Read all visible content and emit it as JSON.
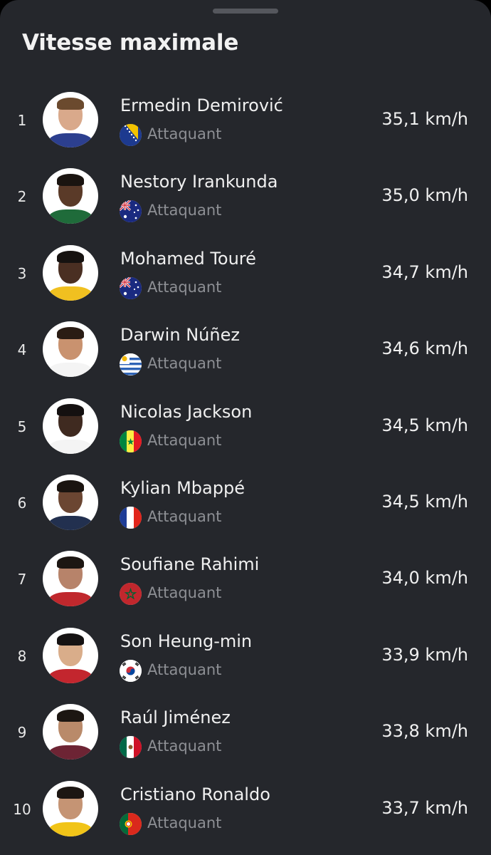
{
  "sheet": {
    "title": "Vitesse maximale"
  },
  "players": [
    {
      "rank": "1",
      "name": "Ermedin Demirović",
      "position": "Attaquant",
      "speed": "35,1 km/h",
      "flag_icon": "bosnia-flag-icon",
      "skin": "#d9a98b",
      "hair": "#6b4a2e",
      "shirt": "#2c3f8f"
    },
    {
      "rank": "2",
      "name": "Nestory Irankunda",
      "position": "Attaquant",
      "speed": "35,0 km/h",
      "flag_icon": "australia-flag-icon",
      "skin": "#5a3a28",
      "hair": "#1a1410",
      "shirt": "#1f6b3a"
    },
    {
      "rank": "3",
      "name": "Mohamed Touré",
      "position": "Attaquant",
      "speed": "34,7 km/h",
      "flag_icon": "australia-flag-icon",
      "skin": "#4a2f22",
      "hair": "#161210",
      "shirt": "#f0c020"
    },
    {
      "rank": "4",
      "name": "Darwin Núñez",
      "position": "Attaquant",
      "speed": "34,6 km/h",
      "flag_icon": "uruguay-flag-icon",
      "skin": "#c9926f",
      "hair": "#2a1c14",
      "shirt": "#f4f4f4"
    },
    {
      "rank": "5",
      "name": "Nicolas Jackson",
      "position": "Attaquant",
      "speed": "34,5 km/h",
      "flag_icon": "senegal-flag-icon",
      "skin": "#3f2a20",
      "hair": "#141010",
      "shirt": "#f4f4f4"
    },
    {
      "rank": "6",
      "name": "Kylian Mbappé",
      "position": "Attaquant",
      "speed": "34,5 km/h",
      "flag_icon": "france-flag-icon",
      "skin": "#6b4632",
      "hair": "#1a1410",
      "shirt": "#22304f"
    },
    {
      "rank": "7",
      "name": "Soufiane Rahimi",
      "position": "Attaquant",
      "speed": "34,0 km/h",
      "flag_icon": "morocco-flag-icon",
      "skin": "#b7836a",
      "hair": "#1c1612",
      "shirt": "#c0282d"
    },
    {
      "rank": "8",
      "name": "Son Heung-min",
      "position": "Attaquant",
      "speed": "33,9 km/h",
      "flag_icon": "south-korea-flag-icon",
      "skin": "#d9ad8a",
      "hair": "#151212",
      "shirt": "#c3262e"
    },
    {
      "rank": "9",
      "name": "Raúl Jiménez",
      "position": "Attaquant",
      "speed": "33,8 km/h",
      "flag_icon": "mexico-flag-icon",
      "skin": "#b98a6a",
      "hair": "#1c1612",
      "shirt": "#6d2434"
    },
    {
      "rank": "10",
      "name": "Cristiano Ronaldo",
      "position": "Attaquant",
      "speed": "33,7 km/h",
      "flag_icon": "portugal-flag-icon",
      "skin": "#c59474",
      "hair": "#1c1612",
      "shirt": "#f1c418"
    }
  ],
  "colors": {
    "sheet_background": "#25272c",
    "primary_text": "#f0f0f0",
    "secondary_text": "#8d8f94",
    "handle": "#55575d"
  }
}
